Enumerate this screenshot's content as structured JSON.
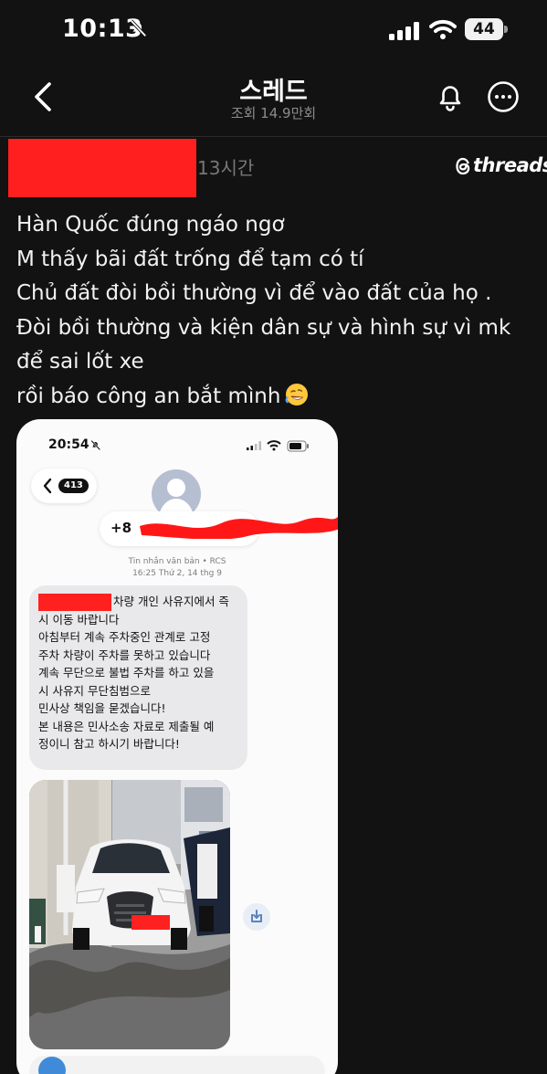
{
  "status_bar": {
    "time": "10:13",
    "battery": "44"
  },
  "header": {
    "title": "스레드",
    "subtitle": "조회 14.9만회"
  },
  "post": {
    "time": "13시간",
    "brand": "threads",
    "lines": [
      "Hàn Quốc đúng ngáo ngơ",
      "M thấy bãi đất trống để tạm có tí",
      "Chủ đất đòi bồi thường vì để vào đất của họ .",
      "Đòi bồi thường và kiện dân sự và hình sự vì mk để sai lốt xe",
      "rồi báo công an bắt mình"
    ],
    "emoji": "rolling-on-floor-laughing"
  },
  "screenshot": {
    "status_time": "20:54",
    "back_count": "413",
    "contact_prefix": "+8",
    "message_type": "Tin nhắn văn bản • RCS",
    "message_date": "16:25 Thứ 2, 14 thg 9",
    "message_lines": [
      "차량 개인 사유지에서 즉",
      "시 이동 바랍니다",
      "아침부터 계속 주차중인 관계로 고정",
      "주차 차량이 주차를 못하고 있습니다",
      "계속 무단으로 불법 주차를 하고 있을",
      "시 사유지 무단침범으로",
      "민사상 책임을 묻겠습니다!",
      "본 내용은 민사소송 자료로 제출될 예",
      "정이니 참고 하시기 바랍니다!"
    ]
  },
  "colors": {
    "background": "#121212",
    "text": "#f2f2f2",
    "muted": "#8c8c8c",
    "redaction": "#ff1f1f",
    "bubble": "#e9e9eb"
  }
}
